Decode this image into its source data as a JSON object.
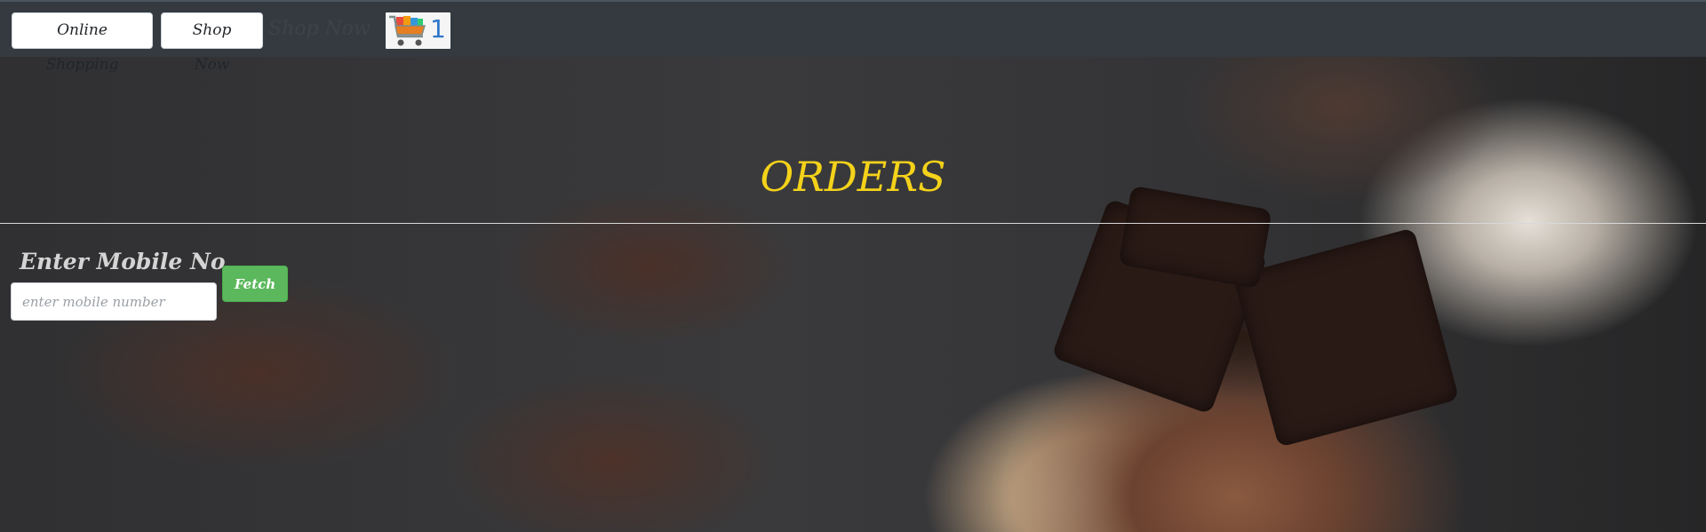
{
  "navbar": {
    "online_shopping_label": "Online Shopping",
    "shop_now_label": "Shop Now",
    "ghost_brand_text": "Shop Now",
    "cart_count": "1"
  },
  "main": {
    "title": "ORDERS",
    "form_label": "Enter Mobile No",
    "mobile_placeholder": "enter mobile number",
    "fetch_label": "Fetch"
  },
  "colors": {
    "navbar_bg": "#343a40",
    "title": "#f4d21a",
    "fetch_button": "#5cb85c",
    "cart_count": "#2f76c8"
  },
  "icons": {
    "cart": "shopping-cart-icon"
  }
}
